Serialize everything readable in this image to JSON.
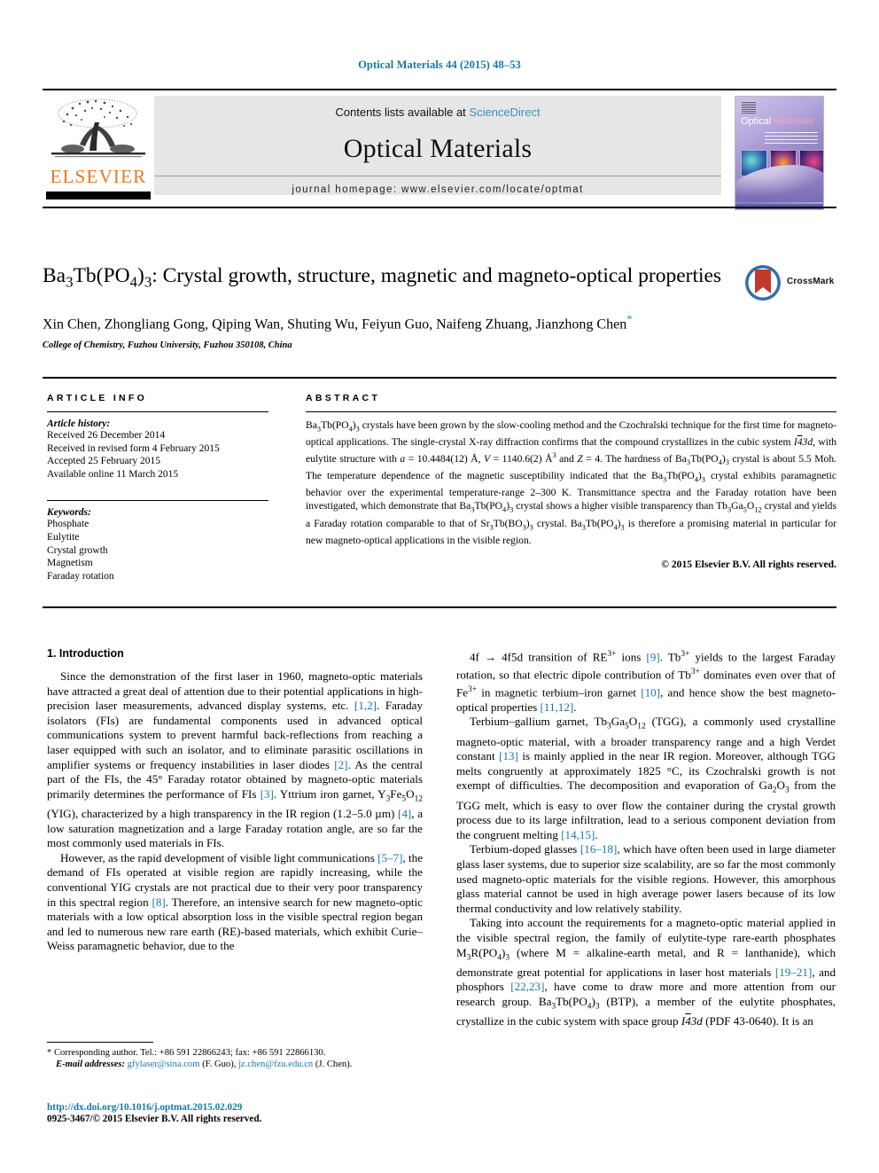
{
  "running_head": "Optical Materials 44 (2015) 48–53",
  "header": {
    "contents_prefix": "Contents lists available at ",
    "sciencedirect": "ScienceDirect",
    "journal_name": "Optical Materials",
    "homepage": "journal homepage: www.elsevier.com/locate/optmat",
    "publisher": "ELSEVIER",
    "cover_title_a": "Optical ",
    "cover_title_b": "Materials"
  },
  "title": {
    "line1_html": "Ba<sub>3</sub>Tb(PO<sub>4</sub>)<sub>3</sub>: Crystal growth, structure, magnetic and magneto-optical properties",
    "crossmark_label": "CrossMark"
  },
  "authors": "Xin Chen, Zhongliang Gong, Qiping Wan, Shuting Wu, Feiyun Guo, Naifeng Zhuang, Jianzhong Chen",
  "author_marker": "*",
  "affiliation": "College of Chemistry, Fuzhou University, Fuzhou 350108, China",
  "article_info": {
    "heading": "ARTICLE INFO",
    "history_label": "Article history:",
    "history": [
      "Received 26 December 2014",
      "Received in revised form 4 February 2015",
      "Accepted 25 February 2015",
      "Available online 11 March 2015"
    ],
    "keywords_label": "Keywords:",
    "keywords": [
      "Phosphate",
      "Eulytite",
      "Crystal growth",
      "Magnetism",
      "Faraday rotation"
    ]
  },
  "abstract": {
    "heading": "ABSTRACT",
    "body_html": "Ba<sub>3</sub>Tb(PO<sub>4</sub>)<sub>3</sub> crystals have been grown by the slow-cooling method and the Czochralski technique for the first time for magneto-optical applications. The single-crystal X-ray diffraction confirms that the compound crystallizes in the cubic system <span class=\"it\">I</span><span class=\"it ovl\">4</span><span class=\"it\">3d</span>, with eulytite structure with <span class=\"it\">a</span> = 10.4484(12) Å, <span class=\"it\">V</span> = 1140.6(2) Å<sup>3</sup> and <span class=\"it\">Z</span> = 4. The hardness of Ba<sub>3</sub>Tb(PO<sub>4</sub>)<sub>3</sub> crystal is about 5.5 Moh. The temperature dependence of the magnetic susceptibility indicated that the Ba<sub>3</sub>Tb(PO<sub>4</sub>)<sub>3</sub> crystal exhibits paramagnetic behavior over the experimental temperature-range 2–300 K. Transmittance spectra and the Faraday rotation have been investigated, which demonstrate that Ba<sub>3</sub>Tb(PO<sub>4</sub>)<sub>3</sub> crystal shows a higher visible transparency than Tb<sub>3</sub>Ga<sub>5</sub>O<sub>12</sub> crystal and yields a Faraday rotation comparable to that of Sr<sub>3</sub>Tb(BO<sub>3</sub>)<sub>3</sub> crystal. Ba<sub>3</sub>Tb(PO<sub>4</sub>)<sub>3</sub> is therefore a promising material in particular for new magneto-optical applications in the visible region.",
    "copyright": "© 2015 Elsevier B.V. All rights reserved."
  },
  "section": {
    "number_title": "1. Introduction"
  },
  "left_column_paragraphs_html": [
    "Since the demonstration of the first laser in 1960, magneto-optic materials have attracted a great deal of attention due to their potential applications in high-precision laser measurements, advanced display systems, etc. <span class=\"ref\">[1,2]</span>. Faraday isolators (FIs) are fundamental components used in advanced optical communications system to prevent harmful back-reflections from reaching a laser equipped with such an isolator, and to eliminate parasitic oscillations in amplifier systems or frequency instabilities in laser diodes <span class=\"ref\">[2]</span>. As the central part of the FIs, the 45° Faraday rotator obtained by magneto-optic materials primarily determines the performance of FIs <span class=\"ref\">[3]</span>. Yttrium iron garnet, Y<sub>3</sub>Fe<sub>5</sub>O<sub>12</sub> (YIG), characterized by a high transparency in the IR region (1.2–5.0 µm) <span class=\"ref\">[4]</span>, a low saturation magnetization and a large Faraday rotation angle, are so far the most commonly used materials in FIs.",
    "However, as the rapid development of visible light communications <span class=\"ref\">[5–7]</span>, the demand of FIs operated at visible region are rapidly increasing, while the conventional YIG crystals are not practical due to their very poor transparency in this spectral region <span class=\"ref\">[8]</span>. Therefore, an intensive search for new magneto-optic materials with a low optical absorption loss in the visible spectral region began and led to numerous new rare earth (RE)-based materials, which exhibit Curie–Weiss paramagnetic behavior, due to the"
  ],
  "right_column_paragraphs_html": [
    "4f → 4f5d transition of RE<sup>3+</sup> ions <span class=\"ref\">[9]</span>. Tb<sup>3+</sup> yields to the largest Faraday rotation, so that electric dipole contribution of Tb<sup>3+</sup> dominates even over that of Fe<sup>3+</sup> in magnetic terbium–iron garnet <span class=\"ref\">[10]</span>, and hence show the best magneto-optical properties <span class=\"ref\">[11,12]</span>.",
    "Terbium–gallium garnet, Tb<sub>3</sub>Ga<sub>5</sub>O<sub>12</sub> (TGG), a commonly used crystalline magneto-optic material, with a broader transparency range and a high Verdet constant <span class=\"ref\">[13]</span> is mainly applied in the near IR region. Moreover, although TGG melts congruently at approximately 1825 °C, its Czochralski growth is not exempt of difficulties. The decomposition and evaporation of Ga<sub>2</sub>O<sub>3</sub> from the TGG melt, which is easy to over flow the container during the crystal growth process due to its large infiltration, lead to a serious component deviation from the congruent melting <span class=\"ref\">[14,15]</span>.",
    "Terbium-doped glasses <span class=\"ref\">[16–18]</span>, which have often been used in large diameter glass laser systems, due to superior size scalability, are so far the most commonly used magneto-optic materials for the visible regions. However, this amorphous glass material cannot be used in high average power lasers because of its low thermal conductivity and low relatively stability.",
    "Taking into account the requirements for a magneto-optic material applied in the visible spectral region, the family of eulytite-type rare-earth phosphates M<sub>3</sub>R(PO<sub>4</sub>)<sub>3</sub> (where M = alkaline-earth metal, and R = lanthanide), which demonstrate great potential for applications in laser host materials <span class=\"ref\">[19–21]</span>, and phosphors <span class=\"ref\">[22,23]</span>, have come to draw more and more attention from our research group. Ba<sub>3</sub>Tb(PO<sub>4</sub>)<sub>3</sub> (BTP), a member of the eulytite phosphates, crystallize in the cubic system with space group <span class=\"it\">I</span><span class=\"it ovl\">4</span><span class=\"it\">3d</span> (PDF 43-0640). It is an"
  ],
  "footnote": {
    "corresponding_html": "* Corresponding author. Tel.: +86 591 22866243; fax: +86 591 22866130.",
    "email_label": "E-mail addresses:",
    "email_html": "<span class=\"fn-email\">gfylaser@sina.com</span> (F. Guo), <span class=\"fn-email\">jz.chen@fzu.edu.cn</span> (J. Chen)."
  },
  "footer": {
    "doi": "http://dx.doi.org/10.1016/j.optmat.2015.02.029",
    "issn": "0925-3467/© 2015 Elsevier B.V. All rights reserved."
  },
  "colors": {
    "link_blue": "#1878a8",
    "sciencedirect_blue": "#3c8fc4",
    "elsevier_orange": "#e87722",
    "band_grey": "#e6e6e6"
  }
}
